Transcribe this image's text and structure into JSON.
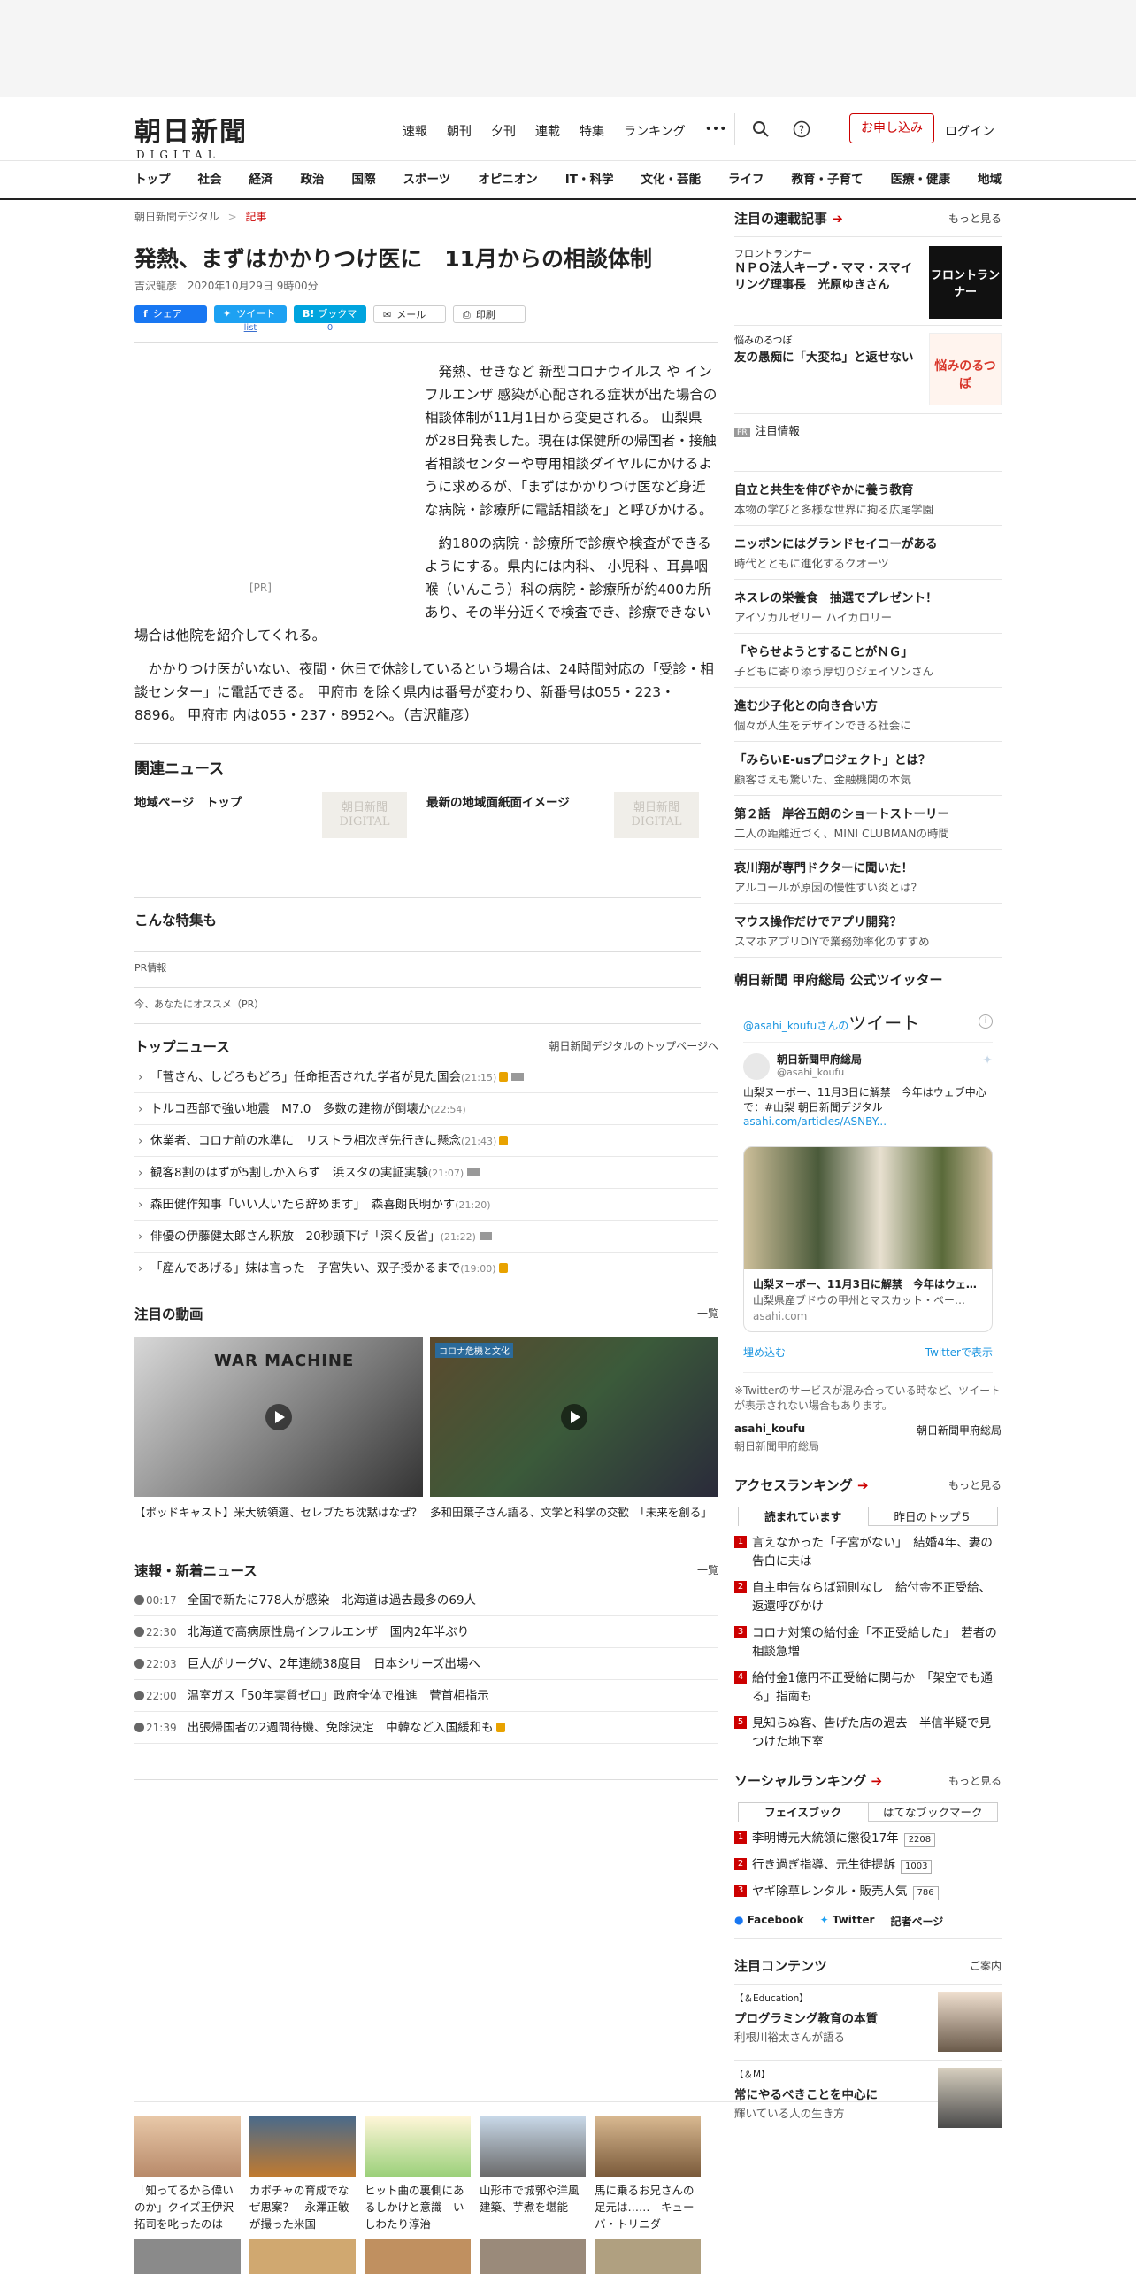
{
  "header": {
    "logo_main": "朝日新聞",
    "logo_sub": "DIGITAL",
    "nav": [
      "速報",
      "朝刊",
      "夕刊",
      "連載",
      "特集",
      "ランキング",
      "•••"
    ],
    "subscribe": "お申し込み",
    "login": "ログイン"
  },
  "categories": [
    "トップ",
    "社会",
    "経済",
    "政治",
    "国際",
    "スポーツ",
    "オピニオン",
    "IT・科学",
    "文化・芸能",
    "ライフ",
    "教育・子育て",
    "医療・健康",
    "地域"
  ],
  "breadcrumb": {
    "home": "朝日新聞デジタル",
    "sep": ">",
    "current": "記事"
  },
  "article": {
    "title": "発熱、まずはかかりつけ医に　11月からの相談体制",
    "byline": "吉沢龍彦",
    "date": "2020年10月29日 9時00分",
    "share": {
      "facebook": "シェア",
      "tweet": "ツイート",
      "tweet_count": "list",
      "bookmark": "ブックマーク",
      "bookmark_count": "0",
      "mail": "メール",
      "print": "印刷"
    },
    "pr_label": "[PR]",
    "p1": "発熱、せきなど 新型コロナウイルス や インフルエンザ 感染が心配される症状が出た場合の相談体制が11月1日から変更される。 山梨県 が28日発表した。現在は保健所の帰国者・接触者相談センターや専用相談ダイヤルにかけるように求めるが、「まずはかかりつけ医など身近な病院・診療所に電話相談を」と呼びかける。",
    "p2": "約180の病院・診療所で診療や検査ができるようにする。県内には内科、 小児科 、耳鼻咽喉（いんこう）科の病院・診療所が約400カ所あり、その半分近くで検査でき、診療できない場合は他院を紹介してくれる。",
    "p3": "かかりつけ医がいない、夜間・休日で休診しているという場合は、24時間対応の「受診・相談センター」に電話できる。 甲府市 を除く県内は番号が変わり、新番号は055・223・8896。 甲府市 内は055・237・8952へ。（吉沢龍彦）"
  },
  "related": {
    "heading": "関連ニュース",
    "items": [
      {
        "label": "地域ページ　トップ",
        "thumb": "朝日新聞 DIGITAL"
      },
      {
        "label": "最新の地域面紙面イメージ",
        "thumb": "朝日新聞 DIGITAL"
      }
    ]
  },
  "special": {
    "heading": "こんな特集も",
    "pr": "PR情報",
    "recommend": "今、あなたにオススメ（PR）"
  },
  "topnews": {
    "heading": "トップニュース",
    "more": "朝日新聞デジタルのトップページへ",
    "items": [
      {
        "text": "「菅さん、しどろもどろ」任命拒否された学者が見た国会",
        "time": "(21:15)"
      },
      {
        "text": "トルコ西部で強い地震　M7.0　多数の建物が倒壊か",
        "time": "(22:54)"
      },
      {
        "text": "休業者、コロナ前の水準に　リストラ相次ぎ先行きに懸念",
        "time": "(21:43)"
      },
      {
        "text": "観客8割のはずが5割しか入らず　浜スタの実証実験",
        "time": "(21:07)"
      },
      {
        "text": "森田健作知事「いい人いたら辞めます」　森喜朗氏明かす",
        "time": "(21:20)"
      },
      {
        "text": "俳優の伊藤健太郎さん釈放　20秒頭下げ「深く反省」",
        "time": "(21:22)"
      },
      {
        "text": "「産んであげる」妹は言った　子宮失い、双子授かるまで",
        "time": "(19:00)"
      }
    ]
  },
  "videos": {
    "heading": "注目の動画",
    "more": "一覧",
    "items": [
      {
        "caption": "【ポッドキャスト】米大統領選、セレブたち沈黙はなぜ？",
        "overlay": "WAR MACHINE"
      },
      {
        "caption": "多和田葉子さん語る、文学と科学の交歓　「未来を創る」",
        "overlay": "コロナ危機と文化"
      }
    ]
  },
  "latest": {
    "heading": "速報・新着ニュース",
    "more": "一覧",
    "items": [
      {
        "time": "00:17",
        "text": "全国で新たに778人が感染　北海道は過去最多の69人"
      },
      {
        "time": "22:30",
        "text": "北海道で高病原性鳥インフルエンザ　国内2年半ぶり"
      },
      {
        "time": "22:03",
        "text": "巨人がリーグV、2年連続38度目　日本シリーズ出場へ"
      },
      {
        "time": "22:00",
        "text": "温室ガス「50年実質ゼロ」政府全体で推進　菅首相指示"
      },
      {
        "time": "21:39",
        "text": "出張帰国者の2週間待機、免除決定　中韓など入国緩和も"
      }
    ]
  },
  "bottom_gallery": [
    "「知ってるから偉いのか」クイズ王伊沢拓司を叱ったのは",
    "カボチャの育成でなぜ思案？　永澤正敏が撮った米国",
    "ヒット曲の裏側にあるしかけと意識　いしわたり淳治",
    "山形市で城郭や洋風建築、芋煮を堪能",
    "馬に乗るお兄さんの足元は……　キューバ・トリニダ"
  ],
  "sidebar": {
    "serial": {
      "heading": "注目の連載記事",
      "more": "もっと見る",
      "items": [
        {
          "kicker": "フロントランナー",
          "title": "ＮＰＯ法人キープ・ママ・スマイリング理事長　光原ゆきさん",
          "thumb": "フロントランナー"
        },
        {
          "kicker": "悩みのるつぼ",
          "title": "友の愚痴に「大変ね」と返せない",
          "thumb": "悩みのるつぼ"
        }
      ]
    },
    "notice": "注目情報",
    "pr_badge": "PR",
    "pr_items": [
      {
        "t": "自立と共生を伸びやかに養う教育",
        "s": "本物の学びと多様な世界に拘る広尾学園"
      },
      {
        "t": "ニッポンにはグランドセイコーがある",
        "s": "時代とともに進化するクオーツ"
      },
      {
        "t": "ネスレの栄養食　抽選でプレゼント！",
        "s": "アイソカルゼリー ハイカロリー"
      },
      {
        "t": "「やらせようとすることがＮＧ」",
        "s": "子どもに寄り添う厚切りジェイソンさん"
      },
      {
        "t": "進む少子化との向き合い方",
        "s": "個々が人生をデザインできる社会に"
      },
      {
        "t": "「みらいE-usプロジェクト」とは？",
        "s": "顧客さえも驚いた、金融機関の本気"
      },
      {
        "t": "第２話　岸谷五朗のショートストーリー",
        "s": "二人の距離近づく、MINI CLUBMANの時間"
      },
      {
        "t": "哀川翔が専門ドクターに聞いた！",
        "s": "アルコールが原因の慢性すい炎とは？"
      },
      {
        "t": "マウス操作だけでアプリ開発？",
        "s": "スマホアプリDIYで業務効率化のすすめ"
      }
    ],
    "twitter": {
      "heading": "朝日新聞 甲府総局 公式ツイッター",
      "handle_line": "@asahi_koufuさんの",
      "tweets_label": "ツイート",
      "account_name": "朝日新聞甲府総局",
      "account_handle": "@asahi_koufu",
      "tweet_text": "山梨ヌーボー、11月3日に解禁　今年はウェブ中心で：#山梨 朝日新聞デジタル",
      "tweet_link": "asahi.com/articles/ASNBY...",
      "card_title": "山梨ヌーボー、11月3日に解禁　今年はウェ…",
      "card_desc": "山梨県産ブドウの甲州とマスカット・ベー…",
      "card_domain": "asahi.com",
      "embed": "埋め込む",
      "view_on": "Twitterで表示",
      "note": "※Twitterのサービスが混み合っている時など、ツイートが表示されない場合もあります。",
      "footer_handle": "asahi_koufu",
      "footer_img_alt": "朝日新聞甲府総局",
      "footer_name": "朝日新聞甲府総局"
    },
    "access": {
      "heading": "アクセスランキング",
      "more": "もっと見る",
      "tabs": [
        "読まれています",
        "昨日のトップ５"
      ],
      "items": [
        "言えなかった「子宮がない」　結婚4年、妻の告白に夫は",
        "自主申告ならば罰則なし　給付金不正受給、返還呼びかけ",
        "コロナ対策の給付金「不正受給した」　若者の相談急増",
        "給付金1億円不正受給に関与か　「架空でも通る」指南も",
        "見知らぬ客、告げた店の過去　半信半疑で見つけた地下室"
      ]
    },
    "social": {
      "heading": "ソーシャルランキング",
      "more": "もっと見る",
      "tabs": [
        "フェイスブック",
        "はてなブックマーク"
      ],
      "items": [
        {
          "text": "李明博元大統領に懲役17年",
          "count": "2208"
        },
        {
          "text": "行き過ぎ指導、元生徒提訴",
          "count": "1003"
        },
        {
          "text": "ヤギ除草レンタル・販売人気",
          "count": "786"
        }
      ],
      "links": [
        "Facebook",
        "Twitter",
        "記者ページ"
      ]
    },
    "contents": {
      "heading": "注目コンテンツ",
      "more": "ご案内",
      "items": [
        {
          "kicker": "【＆Education】",
          "title": "プログラミング教育の本質",
          "sub": "利根川裕太さんが語る"
        },
        {
          "kicker": "【＆M】",
          "title": "常にやるべきことを中心に",
          "sub": "輝いている人の生き方"
        }
      ]
    }
  }
}
